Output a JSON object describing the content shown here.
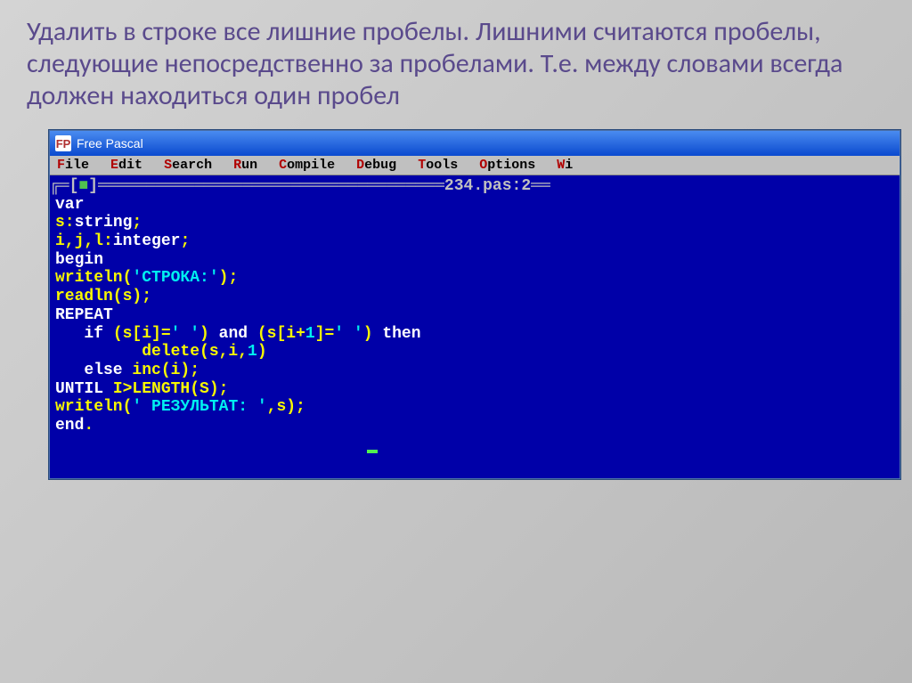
{
  "heading": "Удалить в строке все лишние пробелы. Лишними считаются пробелы, следующие непосредственно за пробелами. Т.е. между словами всегда должен находиться один пробел",
  "window": {
    "title": "Free Pascal",
    "icon_label": "FP"
  },
  "menu": {
    "file": "File",
    "edit": "Edit",
    "search": "Search",
    "run": "Run",
    "compile": "Compile",
    "debug": "Debug",
    "tools": "Tools",
    "options": "Options",
    "wi": "Wi"
  },
  "editor": {
    "tab_label": "234.pas:2",
    "code": {
      "l1": "var",
      "l2a": "s:",
      "l2b": "string",
      "l2c": ";",
      "l3a": "i,j,l:",
      "l3b": "integer",
      "l3c": ";",
      "l4": "begin",
      "l5a": "writeln(",
      "l5b": "'СТРОКА:'",
      "l5c": ");",
      "l6": "readln(s);",
      "l7": "REPEAT",
      "l8a": "   if",
      "l8b": " (s[i]=",
      "l8c": "' '",
      "l8d": ") ",
      "l8e": "and",
      "l8f": " (s[i+",
      "l8g": "1",
      "l8h": "]=",
      "l8i": "' '",
      "l8j": ") ",
      "l8k": "then",
      "l9a": "         delete(s,i,",
      "l9b": "1",
      "l9c": ")",
      "l10a": "   else",
      "l10b": " inc(i);",
      "l11a": "UNTIL",
      "l11b": " I>LENGTH(S);",
      "l12a": "writeln(",
      "l12b": "' РЕЗУЛЬТАТ: '",
      "l12c": ",s);",
      "l13a": "end",
      "l13b": "."
    }
  }
}
